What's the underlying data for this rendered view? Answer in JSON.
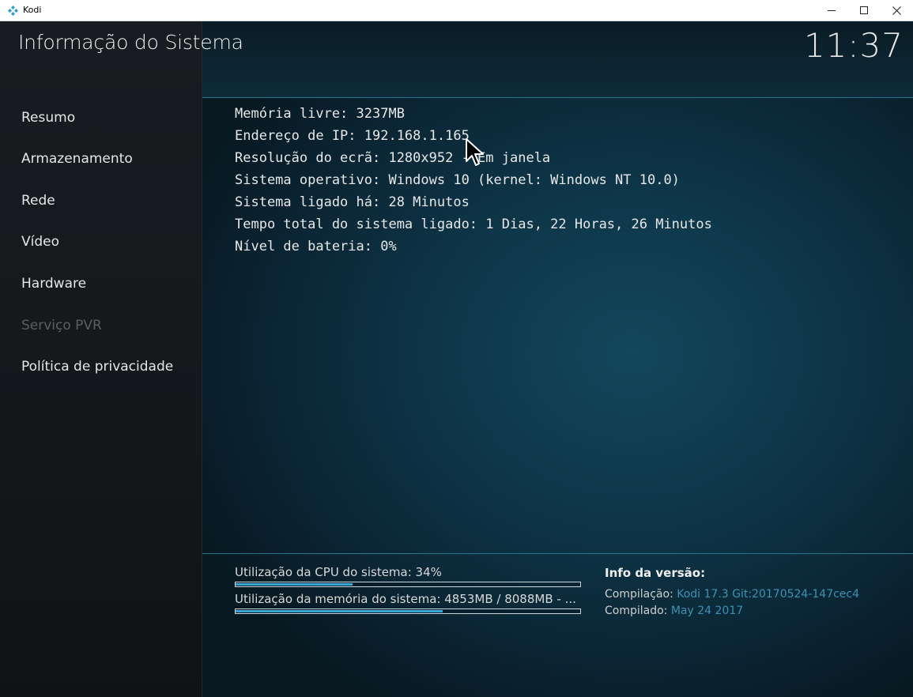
{
  "window": {
    "title": "Kodi"
  },
  "header": {
    "title": "Informação do Sistema",
    "clock": "11:37"
  },
  "sidebar": {
    "items": [
      {
        "label": "Resumo"
      },
      {
        "label": "Armazenamento"
      },
      {
        "label": "Rede"
      },
      {
        "label": "Vídeo"
      },
      {
        "label": "Hardware"
      },
      {
        "label": "Serviço PVR"
      },
      {
        "label": "Política de privacidade"
      }
    ]
  },
  "info": {
    "lines": [
      "Memória livre: 3237MB",
      "Endereço de IP: 192.168.1.165",
      "Resolução do ecrã: 1280x952 - Em janela",
      "Sistema operativo: Windows 10 (kernel: Windows NT 10.0)",
      "Sistema ligado há: 28 Minutos",
      "Tempo total do sistema ligado: 1 Dias, 22 Horas, 26 Minutos",
      "Nível de bateria: 0%"
    ]
  },
  "stats": {
    "cpu_label": "Utilização da CPU do sistema: 34%",
    "cpu_value": 0.34,
    "mem_label": "Utilização da memória do sistema: 4853MB / 8088MB - ...",
    "mem_value": 0.6
  },
  "version": {
    "title": "Info da versão:",
    "build_label": "Compilação:",
    "build_value": "Kodi 17.3 Git:20170524-147cec4",
    "compiled_label": "Compilado:",
    "compiled_value": "May 24 2017"
  },
  "colors": {
    "accent": "#3aa7d6",
    "version_value": "#3d93b4",
    "disabled_text": "#5a5f63"
  },
  "icons": {
    "app": "kodi-logo-icon",
    "minimize": "minimize-icon",
    "maximize": "maximize-icon",
    "close": "close-icon",
    "cursor": "mouse-pointer-icon"
  }
}
